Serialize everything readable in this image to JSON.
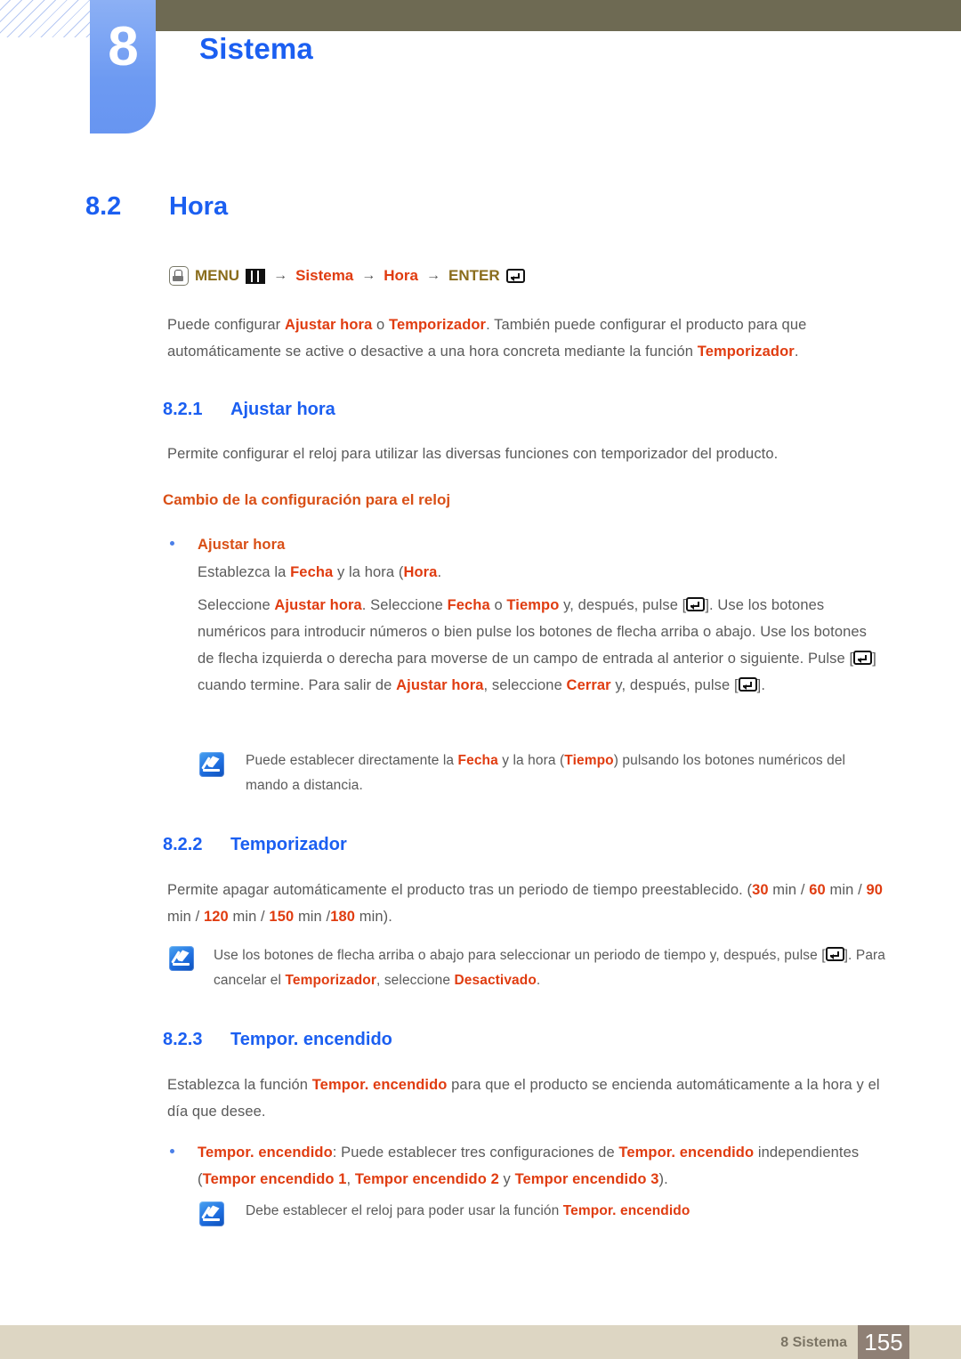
{
  "header": {
    "chapter_number": "8",
    "chapter_title": "Sistema"
  },
  "section": {
    "number": "8.2",
    "title": "Hora"
  },
  "menu_path": {
    "menu_label": "MENU",
    "arrow": "→",
    "item1": "Sistema",
    "item2": "Hora",
    "enter_label": "ENTER",
    "hand_icon": "hand-press-icon",
    "grid_icon": "menu-grid-icon",
    "enter_icon": "enter-key-icon"
  },
  "intro": {
    "line1_a": "Puede configurar ",
    "line1_b": "Ajustar hora",
    "line1_c": " o ",
    "line1_d": "Temporizador",
    "line1_e": ". También puede configurar el producto para que",
    "line2_a": "automáticamente se active o desactive a una hora concreta mediante la función ",
    "line2_b": "Temporizador",
    "line2_c": "."
  },
  "sub1": {
    "number": "8.2.1",
    "title": "Ajustar hora",
    "desc": "Permite configurar el reloj para utilizar las diversas funciones con temporizador del producto.",
    "h3": "Cambio de la configuración para el reloj",
    "bullet_label": "Ajustar hora",
    "b1_a": "Establezca la ",
    "b1_b": "Fecha",
    "b1_c": " y la hora (",
    "b1_d": "Hora",
    "b1_e": ".",
    "p_l1_a": "Seleccione ",
    "p_l1_b": "Ajustar hora",
    "p_l1_c": ". Seleccione ",
    "p_l1_d": "Fecha",
    "p_l1_e": " o ",
    "p_l1_f": "Tiempo",
    "p_l1_g": " y, después, pulse [",
    "p_l1_h": "]. Use los botones",
    "p_l2": "numéricos para introducir números o bien pulse los botones de flecha arriba o abajo. Use los",
    "p_l3": "botones de flecha izquierda o derecha para moverse de un campo de entrada al anterior o",
    "p_l4_a": "siguiente. Pulse [",
    "p_l4_b": "] cuando termine. Para salir de ",
    "p_l4_c": "Ajustar hora",
    "p_l4_d": ", seleccione ",
    "p_l4_e": "Cerrar",
    "p_l4_f": " y, después,",
    "p_l5_a": "pulse [",
    "p_l5_b": "].",
    "note_l1_a": "Puede establecer directamente la ",
    "note_l1_b": "Fecha",
    "note_l1_c": " y la hora (",
    "note_l1_d": "Tiempo",
    "note_l1_e": ") pulsando los botones numéricos del",
    "note_l2": "mando a distancia."
  },
  "sub2": {
    "number": "8.2.2",
    "title": "Temporizador",
    "p_l1_a": "Permite apagar automáticamente el producto tras un periodo de tiempo preestablecido. (",
    "p_l1_b": "30",
    "p_l1_c": " min / ",
    "p_l1_d": "60",
    "p_l1_e": " min",
    "p_l2_a": "/ ",
    "p_l2_b": "90",
    "p_l2_c": " min / ",
    "p_l2_d": "120",
    "p_l2_e": " min / ",
    "p_l2_f": "150",
    "p_l2_g": " min /",
    "p_l2_h": "180",
    "p_l2_i": " min).",
    "note_l1_a": "Use los botones de flecha arriba o abajo para seleccionar un periodo de tiempo y, después, pulse [",
    "note_l1_b": "].",
    "note_l2_a": "Para cancelar el ",
    "note_l2_b": "Temporizador",
    "note_l2_c": ", seleccione ",
    "note_l2_d": "Desactivado",
    "note_l2_e": "."
  },
  "sub3": {
    "number": "8.2.3",
    "title": "Tempor. encendido",
    "p_l1_a": "Establezca la función ",
    "p_l1_b": "Tempor. encendido",
    "p_l1_c": " para que el producto se encienda automáticamente a la hora",
    "p_l2": "y el día que desee.",
    "b_l1_a": "Tempor. encendido",
    "b_l1_b": ": Puede establecer tres configuraciones de ",
    "b_l1_c": "Tempor. encendido",
    "b_l2_a": "independientes (",
    "b_l2_b": "Tempor encendido 1",
    "b_l2_c": ", ",
    "b_l2_d": "Tempor encendido 2",
    "b_l2_e": " y ",
    "b_l2_f": "Tempor encendido 3",
    "b_l2_g": ").",
    "note_a": "Debe establecer el reloj para poder usar la función ",
    "note_b": "Tempor. encendido"
  },
  "footer": {
    "label": "8 Sistema",
    "page": "155"
  },
  "colors": {
    "accent_blue": "#1b5ff1",
    "accent_orange": "#e03c10",
    "olive": "#6e6a53",
    "tab_blue": "#6d9af2",
    "footer_beige": "#ddd6c3",
    "footer_taupe": "#8f8075",
    "body_gray": "#5a5a5a",
    "menu_gold": "#8a6d1c"
  }
}
